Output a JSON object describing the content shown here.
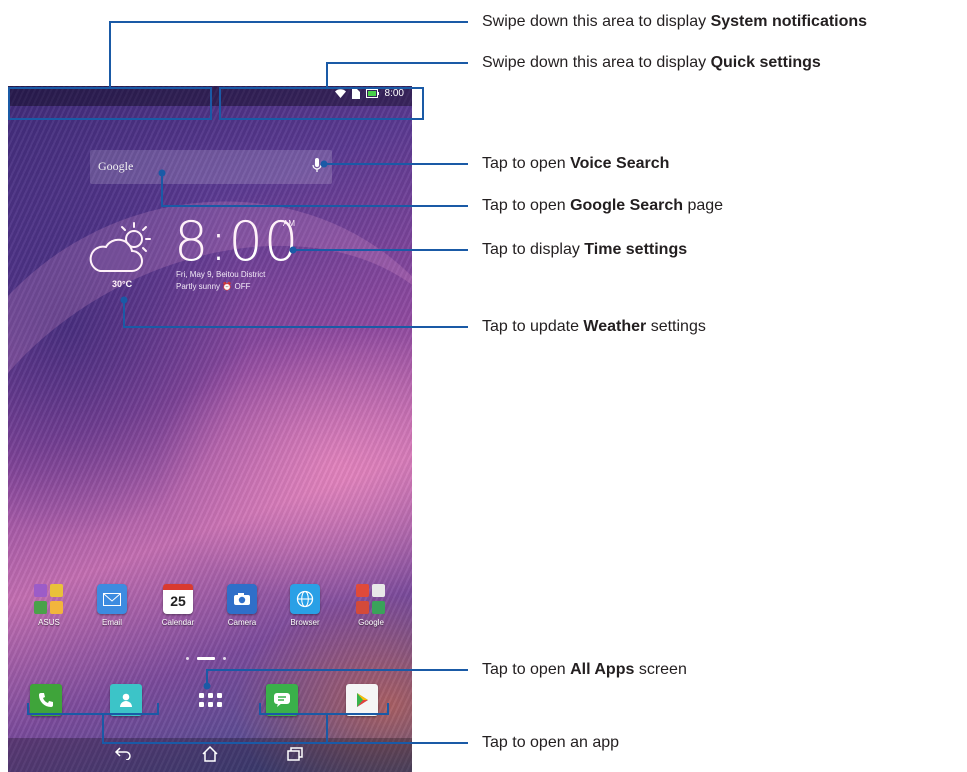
{
  "status_bar": {
    "time": "8:00"
  },
  "search": {
    "label": "Google"
  },
  "clock": {
    "time": "8:00",
    "ampm": "AM",
    "date": "Fri, May 9, Beitou District",
    "weather_text": "Partly sunny",
    "alarm": "OFF",
    "temperature": "30°C"
  },
  "apps": [
    {
      "label": "ASUS"
    },
    {
      "label": "Email"
    },
    {
      "label": "Calendar",
      "day": "25"
    },
    {
      "label": "Camera"
    },
    {
      "label": "Browser"
    },
    {
      "label": "Google"
    }
  ],
  "callouts": [
    {
      "pre": "Swipe down this area to display ",
      "bold": "System notifications",
      "post": ""
    },
    {
      "pre": "Swipe down this area to display ",
      "bold": "Quick settings",
      "post": ""
    },
    {
      "pre": "Tap to open ",
      "bold": "Voice Search",
      "post": ""
    },
    {
      "pre": "Tap to open ",
      "bold": "Google Search",
      "post": " page"
    },
    {
      "pre": "Tap to display ",
      "bold": "Time settings",
      "post": ""
    },
    {
      "pre": "Tap to update ",
      "bold": "Weather",
      "post": " settings"
    },
    {
      "pre": "Tap to open ",
      "bold": "All Apps",
      "post": " screen"
    },
    {
      "pre": "Tap to open an app",
      "bold": "",
      "post": ""
    }
  ],
  "colors": {
    "callout_line": "#1a5aa6",
    "callout_text": "#231f20"
  }
}
